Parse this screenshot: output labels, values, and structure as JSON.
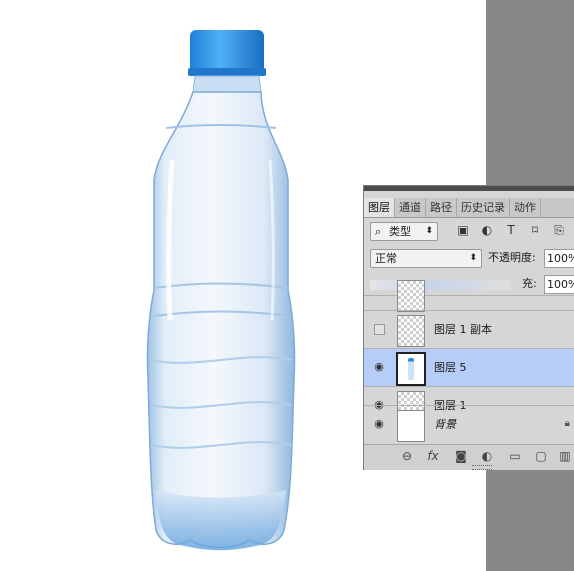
{
  "panel": {
    "tabs": [
      {
        "label": "图层",
        "active": true
      },
      {
        "label": "通道",
        "active": false
      },
      {
        "label": "路径",
        "active": false
      },
      {
        "label": "历史记录",
        "active": false
      },
      {
        "label": "动作",
        "active": false
      }
    ],
    "filter": {
      "icon": "search-icon",
      "label": "类型",
      "arrow": "⬍"
    },
    "filter_icons": [
      "image-filter-icon",
      "adjustment-filter-icon",
      "type-filter-icon",
      "shape-filter-icon",
      "smart-object-filter-icon"
    ],
    "blend": {
      "label": "正常",
      "arrow": "⬍"
    },
    "opacity": {
      "label": "不透明度:",
      "value": "100%"
    },
    "fill": {
      "label": "充:",
      "value": "100%"
    },
    "layers": [
      {
        "name": "图层 1 副本",
        "visible": false,
        "selected": false,
        "thumb": "transparent",
        "locked": false
      },
      {
        "name": "图层 5",
        "visible": true,
        "selected": true,
        "thumb": "bottle",
        "locked": false
      },
      {
        "name": "图层 1",
        "visible": true,
        "selected": false,
        "thumb": "transparent",
        "locked": false
      },
      {
        "name": "背景",
        "visible": true,
        "selected": false,
        "thumb": "white",
        "locked": true
      }
    ],
    "bottom_icons": [
      "link-icon",
      "fx-icon",
      "add-mask-icon",
      "adjustment-layer-icon",
      "new-group-icon",
      "new-layer-icon",
      "delete-icon"
    ],
    "bottom_labels": {
      "fx": "fx"
    }
  },
  "colors": {
    "panel_bg": "#d6d6d6",
    "selected_row": "#b5cdf7",
    "cap_blue": "#2a8de0",
    "workspace_gray": "#888888"
  }
}
